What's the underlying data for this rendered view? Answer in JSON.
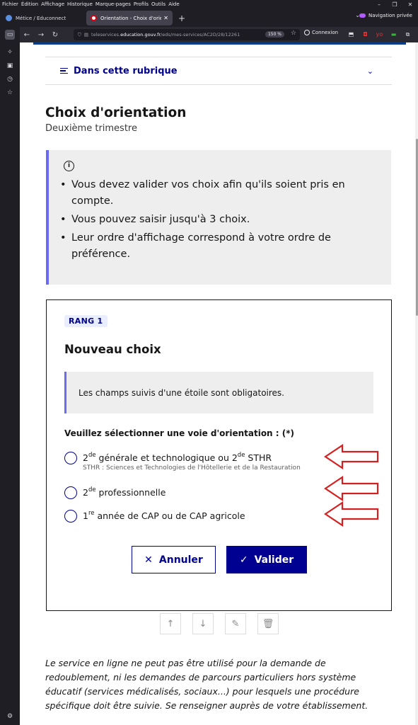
{
  "browser": {
    "menu": [
      "Fichier",
      "Édition",
      "Affichage",
      "Historique",
      "Marque-pages",
      "Profils",
      "Outils",
      "Aide"
    ],
    "tabs": [
      {
        "title": "Métice / Educonnect",
        "active": false
      },
      {
        "title": "Orientation - Choix d'orientatio",
        "active": true
      }
    ],
    "new_tab": "+",
    "private_label": "Navigation privée",
    "url_prefix": "teleservices.",
    "url_domain": "education.gouv.fr",
    "url_path": "/eds/mes-services/AC2D/28/12261",
    "zoom": "150 %",
    "connexion": "Connexion"
  },
  "page": {
    "rubrique_label": "Dans cette rubrique",
    "title": "Choix d'orientation",
    "subtitle": "Deuxième trimestre",
    "info_items": [
      "Vous devez valider vos choix afin qu'ils soient pris en compte.",
      "Vous pouvez saisir jusqu'à 3 choix.",
      "Leur ordre d'affichage correspond à votre ordre de préférence."
    ],
    "card": {
      "badge": "RANG 1",
      "title": "Nouveau choix",
      "notice": "Les champs suivis d'une étoile sont obligatoires.",
      "legend": "Veuillez sélectionner une voie d'orientation : (*)",
      "options": [
        {
          "pre": "2",
          "sup": "de",
          "mid": " générale et technologique ou 2",
          "sup2": "de",
          "post": " STHR",
          "hint": "STHR : Sciences et Technologies de l'Hôtellerie et de la Restauration"
        },
        {
          "pre": "2",
          "sup": "de",
          "post": " professionnelle"
        },
        {
          "pre": "1",
          "sup": "re",
          "post": " année de CAP ou de CAP agricole"
        }
      ],
      "cancel_label": "Annuler",
      "validate_label": "Valider"
    },
    "footer_note": "Le service en ligne ne peut pas être utilisé pour la demande de redoublement, ni les demandes de parcours particuliers hors système éducatif (services médicalisés, sociaux...) pour lesquels une procédure spécifique doit être suivie. Se renseigner auprès de votre établissement."
  },
  "colors": {
    "primary": "#000091",
    "accent": "#6a6af4",
    "annotation_arrow": "#d42020"
  }
}
